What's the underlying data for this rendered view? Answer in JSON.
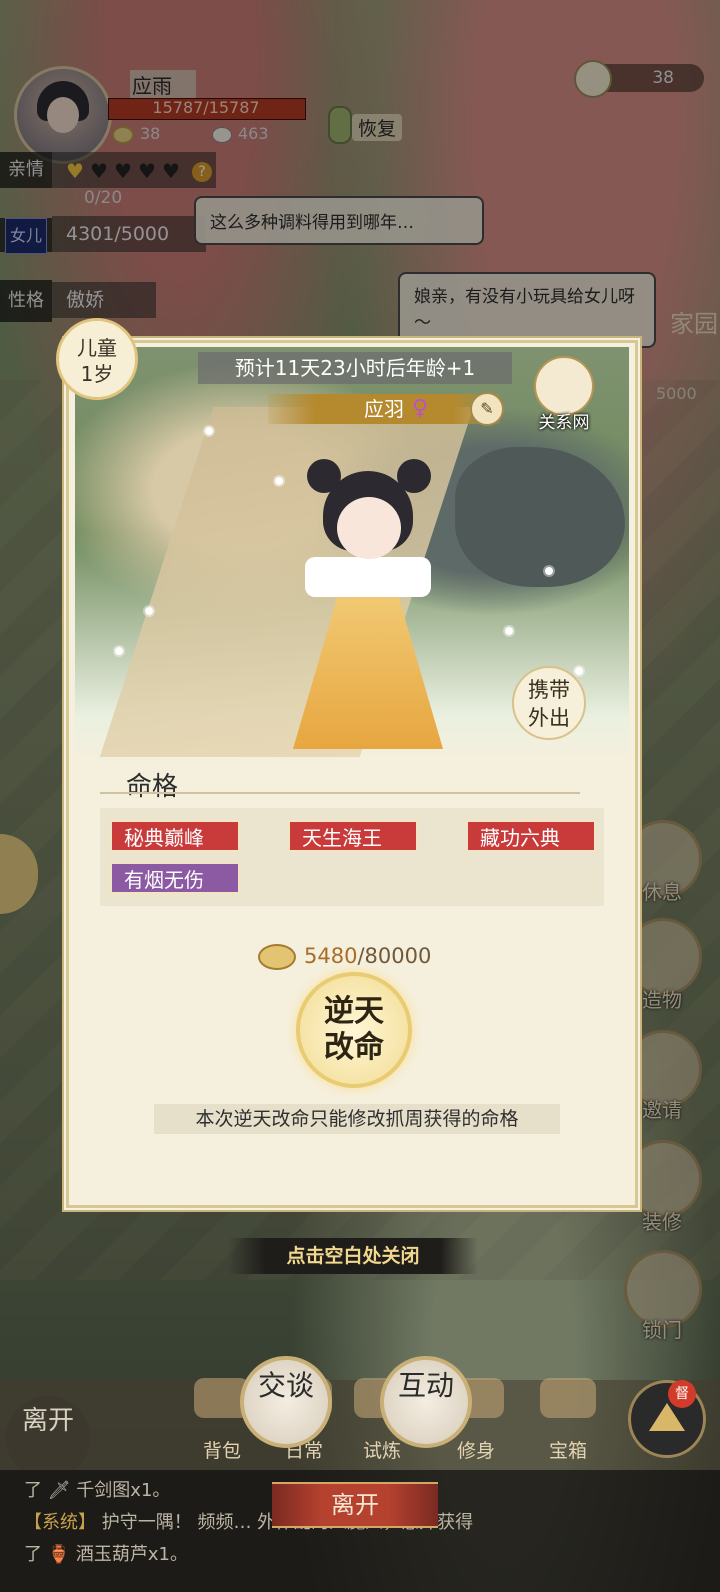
{
  "hud": {
    "name": "应雨",
    "hp_text": "15787/15787",
    "hp_fraction": 1.0,
    "stat_tea": "38",
    "stat_bun": "463",
    "restore_label": "恢复"
  },
  "side": {
    "affection_label": "亲情",
    "affection_hearts_filled": 1,
    "affection_hearts_total": 5,
    "affection_progress": "0/20",
    "daughter_label": "女儿",
    "daughter_value": "4301/5000",
    "personality_label": "性格",
    "personality_value": "傲娇"
  },
  "bubbles": {
    "left": "这么多种调料得用到哪年…",
    "right": "娘亲，有没有小玩具给女儿呀～"
  },
  "top_right": {
    "tea_count": "38",
    "home_label": "家园",
    "money_partial": "5000"
  },
  "card": {
    "age_stage": "儿童",
    "age_years": "1岁",
    "countdown": "预计11天23小时后年龄+1",
    "child_name": "应羽",
    "gender_symbol": "♀",
    "network_label": "关系网",
    "carry_label": "携带外出",
    "fate_title": "命格",
    "fate_tags": [
      {
        "text": "秘典巅峰",
        "color": "red"
      },
      {
        "text": "天生海王",
        "color": "red"
      },
      {
        "text": "藏功六典",
        "color": "red"
      },
      {
        "text": "有烟无伤",
        "color": "purple"
      }
    ],
    "cost_current": "5480",
    "cost_total": "/80000",
    "defy_button": "逆天改命",
    "note": "本次逆天改命只能修改抓周获得的命格"
  },
  "close_hint": "点击空白处关闭",
  "right_buttons": [
    "休息",
    "造物",
    "邀请",
    "装修",
    "锁门"
  ],
  "bottom": {
    "leave_left": "离开",
    "talk": "交谈",
    "interact": "互动",
    "items": [
      "背包",
      "日常",
      "试炼",
      "修身",
      "宝箱"
    ],
    "badge": "督",
    "leave_button": "离开"
  },
  "chat": {
    "line1": "了 🗡 千剑图x1。",
    "line2_tag": "【系统】",
    "line2_text": "护守一隅！ 频频… 外作乱的入魔人，意外获得",
    "line3": "了 🏺 酒玉葫芦x1。"
  },
  "colors": {
    "tag_red": "#c93a3a",
    "tag_purple": "#8b5aa3",
    "accent_gold": "#e0c47c"
  }
}
